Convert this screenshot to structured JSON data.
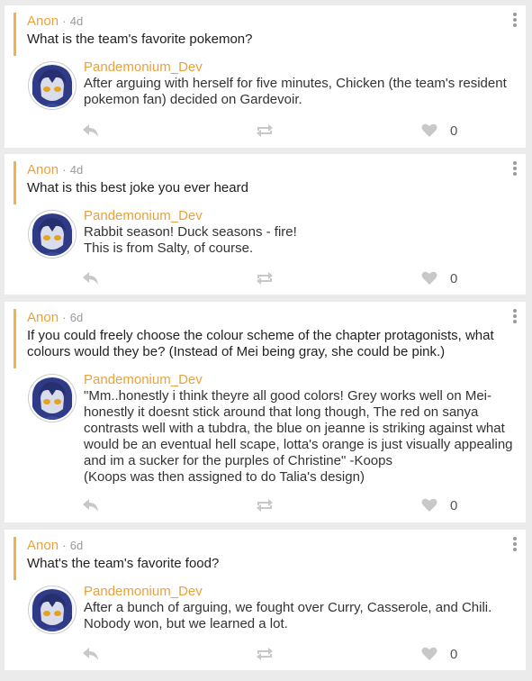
{
  "colors": {
    "accent": "#e8a23a",
    "ask_border": "#f0b44a",
    "icon": "#c8c8c8"
  },
  "icons": {
    "menu": "more-vertical-icon",
    "reply": "reply-icon",
    "reblog": "repost-icon",
    "like": "heart-icon"
  },
  "posts": [
    {
      "asker": "Anon",
      "separator": "·",
      "time": "4d",
      "question": "What is the team's favorite pokemon?",
      "answerer": "Pandemonium_Dev",
      "answer_lines": [
        "After arguing with herself for five minutes, Chicken (the team's resident",
        "pokemon fan) decided on Gardevoir."
      ],
      "likes": "0"
    },
    {
      "asker": "Anon",
      "separator": "·",
      "time": "4d",
      "question": "What is this best joke you ever heard",
      "answerer": "Pandemonium_Dev",
      "answer_lines": [
        "Rabbit season! Duck seasons - fire!",
        "This is from Salty, of course."
      ],
      "likes": "0"
    },
    {
      "asker": "Anon",
      "separator": "·",
      "time": "6d",
      "question": "If you could freely choose the colour scheme of the chapter protagonists, what colours would they be? (Instead of Mei being gray, she could be pink.)",
      "answerer": "Pandemonium_Dev",
      "answer_lines": [
        "\"Mm..honestly i think theyre all good colors! Grey works well on Mei-",
        "honestly it doesnt stick around that long though, The red on sanya",
        "contrasts well with a tubdra, the blue on jeanne is striking against what",
        "would be an eventual hell scape, lotta's orange is just visually appealing",
        "and im a sucker for the purples of Christine\" -Koops",
        "(Koops was then assigned to do Talia's design)"
      ],
      "likes": "0"
    },
    {
      "asker": "Anon",
      "separator": "·",
      "time": "6d",
      "question": "What's the team's favorite food?",
      "answerer": "Pandemonium_Dev",
      "answer_lines": [
        "After a bunch of arguing, we fought over Curry, Casserole, and Chili.",
        "Nobody won, but we learned a lot."
      ],
      "likes": "0"
    }
  ]
}
